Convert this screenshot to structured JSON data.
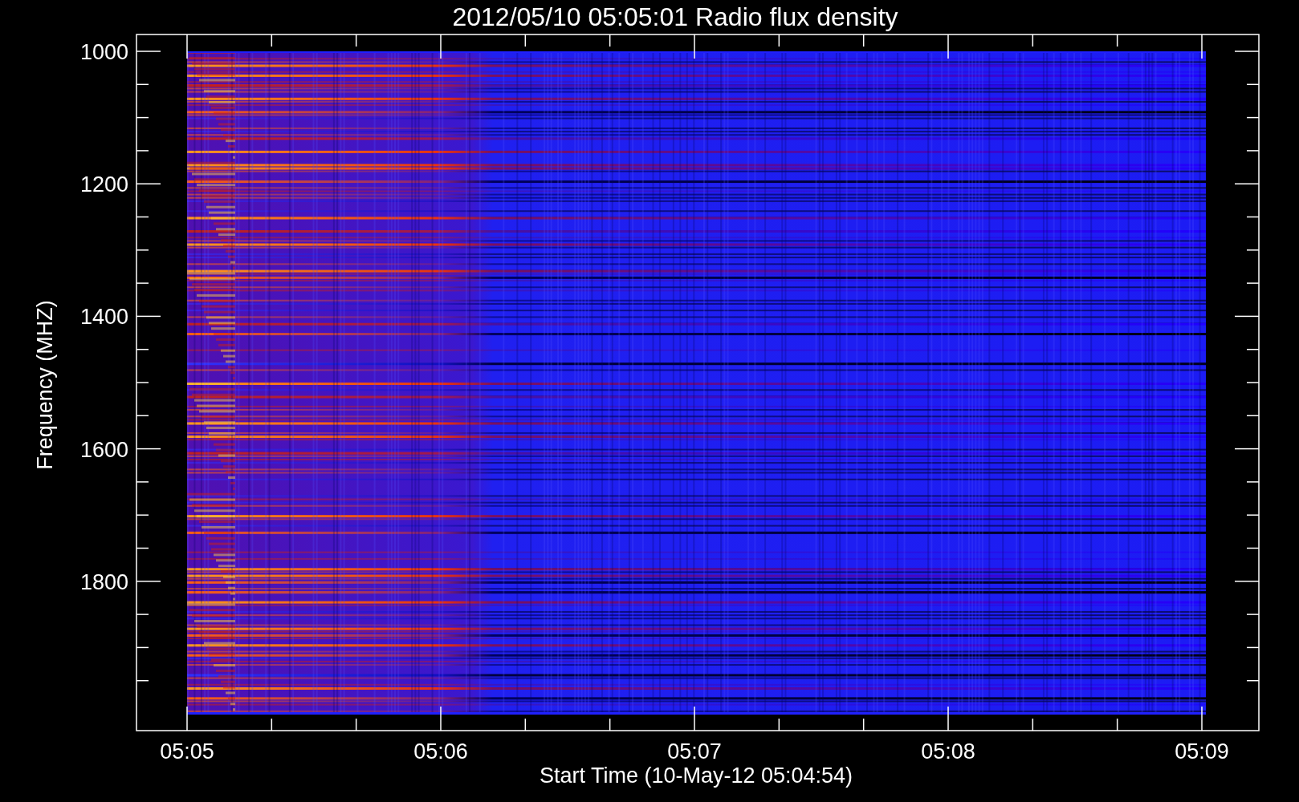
{
  "plot": {
    "title": "2012/05/10 05:05:01 Radio flux density",
    "ylabel": "Frequency (MHZ)",
    "xlabel": "Start Time (10-May-12 05:04:54)",
    "yticks": [
      "1000",
      "1200",
      "1400",
      "1600",
      "1800"
    ],
    "xticks": [
      "05:05",
      "05:06",
      "05:07",
      "05:08",
      "05:09"
    ]
  }
}
